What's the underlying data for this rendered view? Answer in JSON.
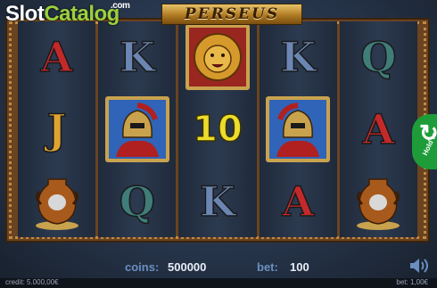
{
  "brand": {
    "slot": "Slot",
    "catalog": "Catalog",
    "com": ".com"
  },
  "game_title": "PERSEUS",
  "reels": [
    [
      "A",
      "J",
      "urn"
    ],
    [
      "K",
      "warrior",
      "Q"
    ],
    [
      "lion",
      "10",
      "K"
    ],
    [
      "K",
      "warrior",
      "A"
    ],
    [
      "Q",
      "A",
      "urn"
    ]
  ],
  "hold_tab": {
    "label": "Hold to"
  },
  "bottom_bar": {
    "coins_label": "coins:",
    "coins_value": "500000",
    "bet_label": "bet:",
    "bet_value": "100"
  },
  "footer": {
    "credit": "credit: 5.000,00€",
    "bet": "bet: 1,00€"
  },
  "colors": {
    "accent_green": "#9bd13c",
    "hold_green": "#1e9c3a",
    "label_blue": "#6a8fc0"
  }
}
